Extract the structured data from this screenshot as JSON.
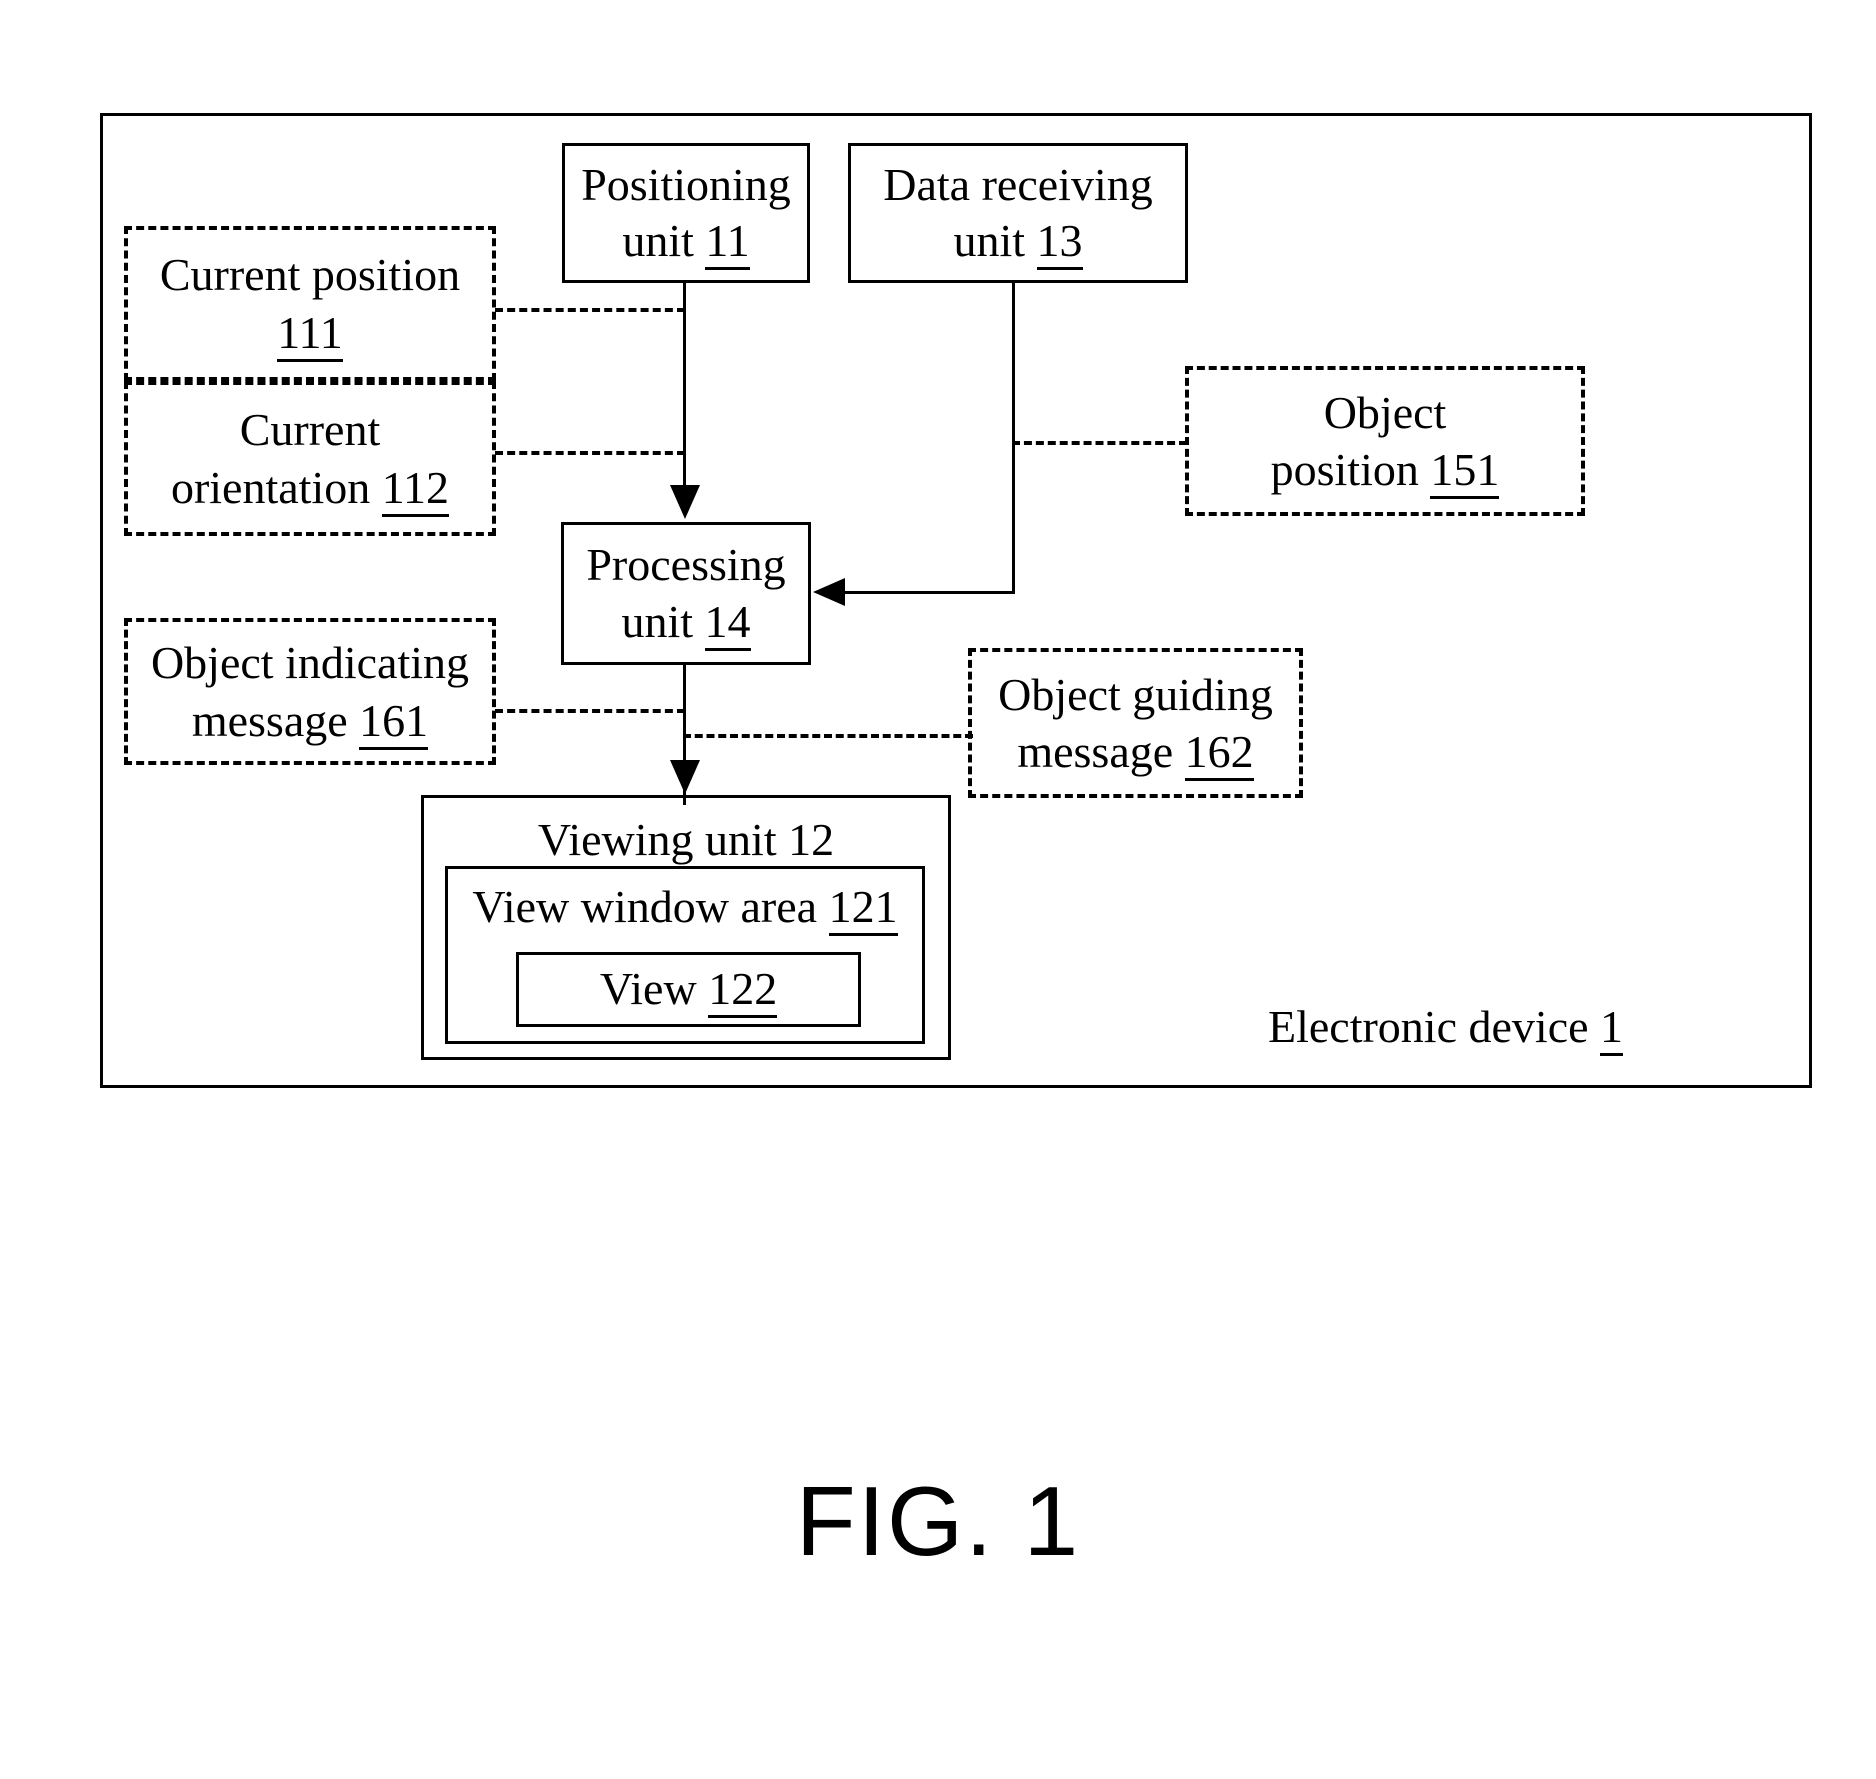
{
  "figure": {
    "caption": "FIG. 1",
    "outer_container_label": {
      "text": "Electronic device ",
      "ref": "1"
    },
    "units": [
      {
        "id": "positioning-unit",
        "line1": "Positioning",
        "line2": "unit ",
        "ref": "11"
      },
      {
        "id": "data-receiving-unit",
        "line1": "Data receiving",
        "line2": "unit ",
        "ref": "13"
      },
      {
        "id": "processing-unit",
        "line1": "Processing",
        "line2": "unit ",
        "ref": "14"
      }
    ],
    "viewing": {
      "unit_label": "Viewing unit ",
      "unit_ref": "12",
      "window_label": "View window area ",
      "window_ref": "121",
      "view_label": "View ",
      "view_ref": "122"
    },
    "data_items": [
      {
        "id": "current-position",
        "line1": "Current position",
        "line2": "",
        "ref": "111"
      },
      {
        "id": "current-orientation",
        "line1": "Current",
        "line2": "orientation ",
        "ref": "112"
      },
      {
        "id": "object-indicating-message",
        "line1": "Object indicating",
        "line2": "message ",
        "ref": "161"
      },
      {
        "id": "object-position",
        "line1": "Object",
        "line2": "position ",
        "ref": "151"
      },
      {
        "id": "object-guiding-message",
        "line1": "Object guiding",
        "line2": "message ",
        "ref": "162"
      }
    ]
  }
}
